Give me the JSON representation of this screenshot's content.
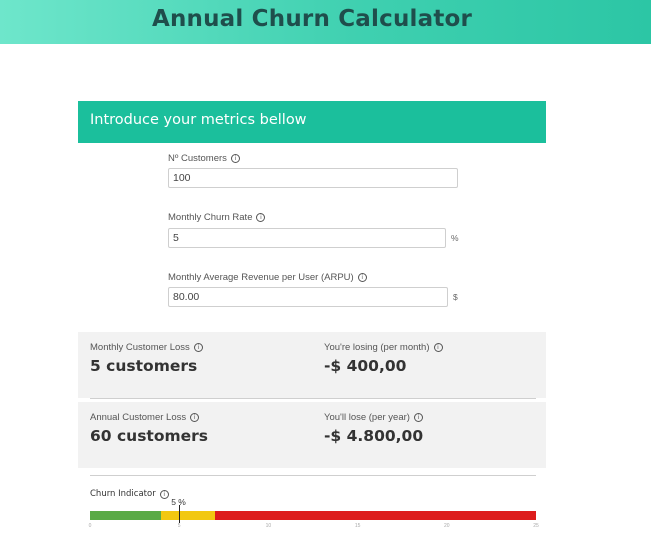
{
  "header": {
    "title": "Annual Churn Calculator"
  },
  "panel": {
    "title": "Introduce your metrics bellow"
  },
  "fields": {
    "customers": {
      "label": "Nº Customers",
      "value": "100",
      "icon": "info-icon"
    },
    "churn_rate": {
      "label": "Monthly Churn Rate",
      "value": "5",
      "unit": "%",
      "icon": "info-icon"
    },
    "arpu": {
      "label": "Monthly Average Revenue per User (ARPU)",
      "value": "80.00",
      "unit": "$",
      "icon": "info-icon"
    }
  },
  "results": {
    "monthly_loss": {
      "label": "Monthly Customer Loss",
      "value": "5 customers"
    },
    "monthly_revenue_loss": {
      "label": "You're losing (per month)",
      "value": "-$ 400,00"
    },
    "annual_loss": {
      "label": "Annual Customer Loss",
      "value": "60 customers"
    },
    "annual_revenue_loss": {
      "label": "You'll lose (per year)",
      "value": "-$ 4.800,00"
    }
  },
  "indicator": {
    "label": "Churn Indicator",
    "pointer_label": "5 %",
    "current_value": 5,
    "scale_min": 0,
    "scale_max": 25,
    "ticks": [
      "0",
      "5",
      "10",
      "15",
      "20",
      "25"
    ],
    "segments": [
      {
        "from": 0,
        "to": 4,
        "color": "#5aaa46"
      },
      {
        "from": 4,
        "to": 7,
        "color": "#f2c811"
      },
      {
        "from": 7,
        "to": 25,
        "color": "#dd1c1c"
      }
    ]
  },
  "colors": {
    "accent": "#1bbf9c",
    "header_gradient_start": "#6ee6cb",
    "header_gradient_end": "#2cc6a5"
  }
}
